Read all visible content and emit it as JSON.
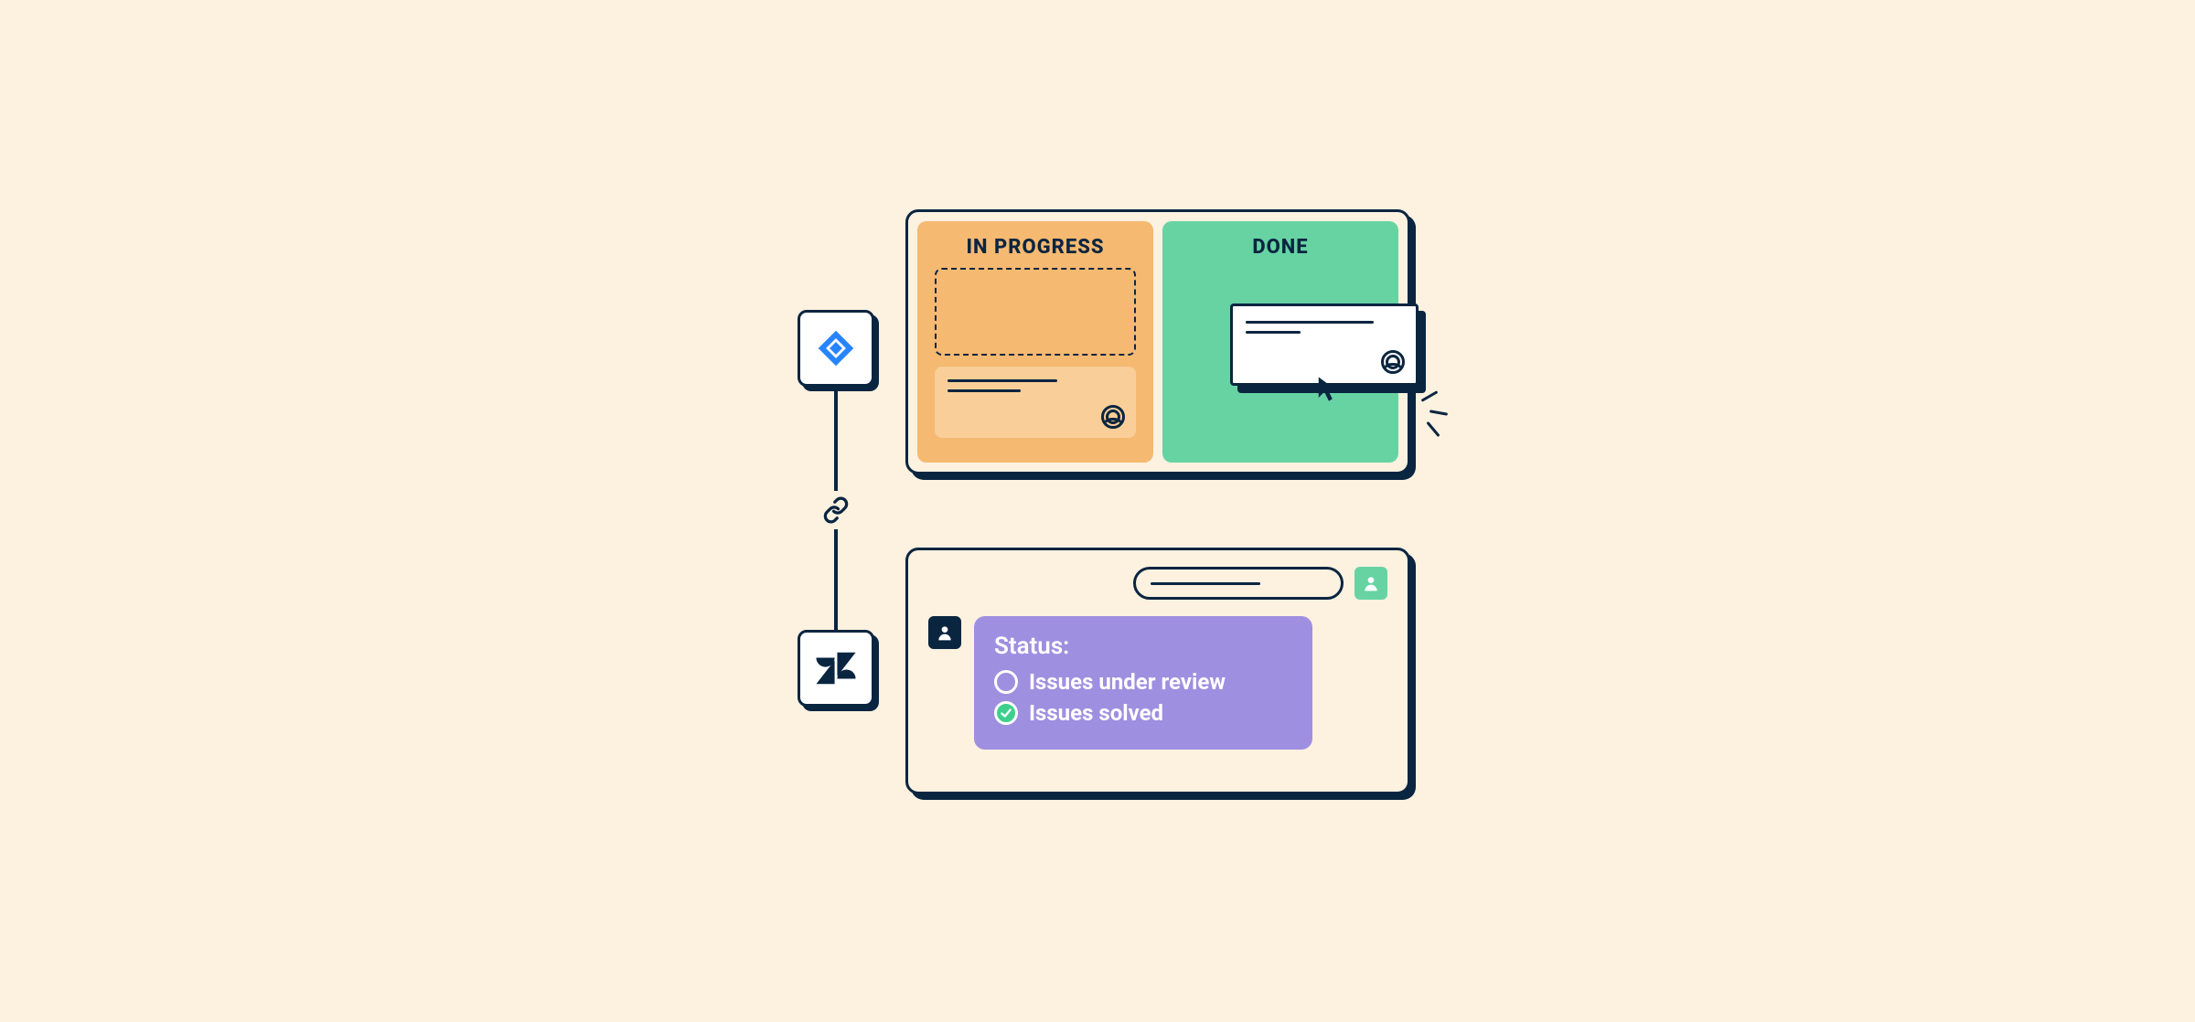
{
  "kanban": {
    "columns": {
      "in_progress": {
        "title": "IN PROGRESS"
      },
      "done": {
        "title": "DONE"
      }
    }
  },
  "status_card": {
    "title": "Status:",
    "items": {
      "under_review": "Issues under review",
      "solved": "Issues solved"
    }
  },
  "icons": {
    "jira": "jira-logo-icon",
    "zendesk": "zendesk-logo-icon",
    "link": "link-icon",
    "cursor": "cursor-icon",
    "avatar": "avatar-icon"
  },
  "colors": {
    "background": "#fdf1e0",
    "ink": "#0a2540",
    "orange": "#f5b971",
    "orange_light": "#f9ce98",
    "green": "#67d3a3",
    "purple": "#9f8fe0",
    "jira_blue": "#2684ff",
    "check_green": "#3ecf8e"
  }
}
